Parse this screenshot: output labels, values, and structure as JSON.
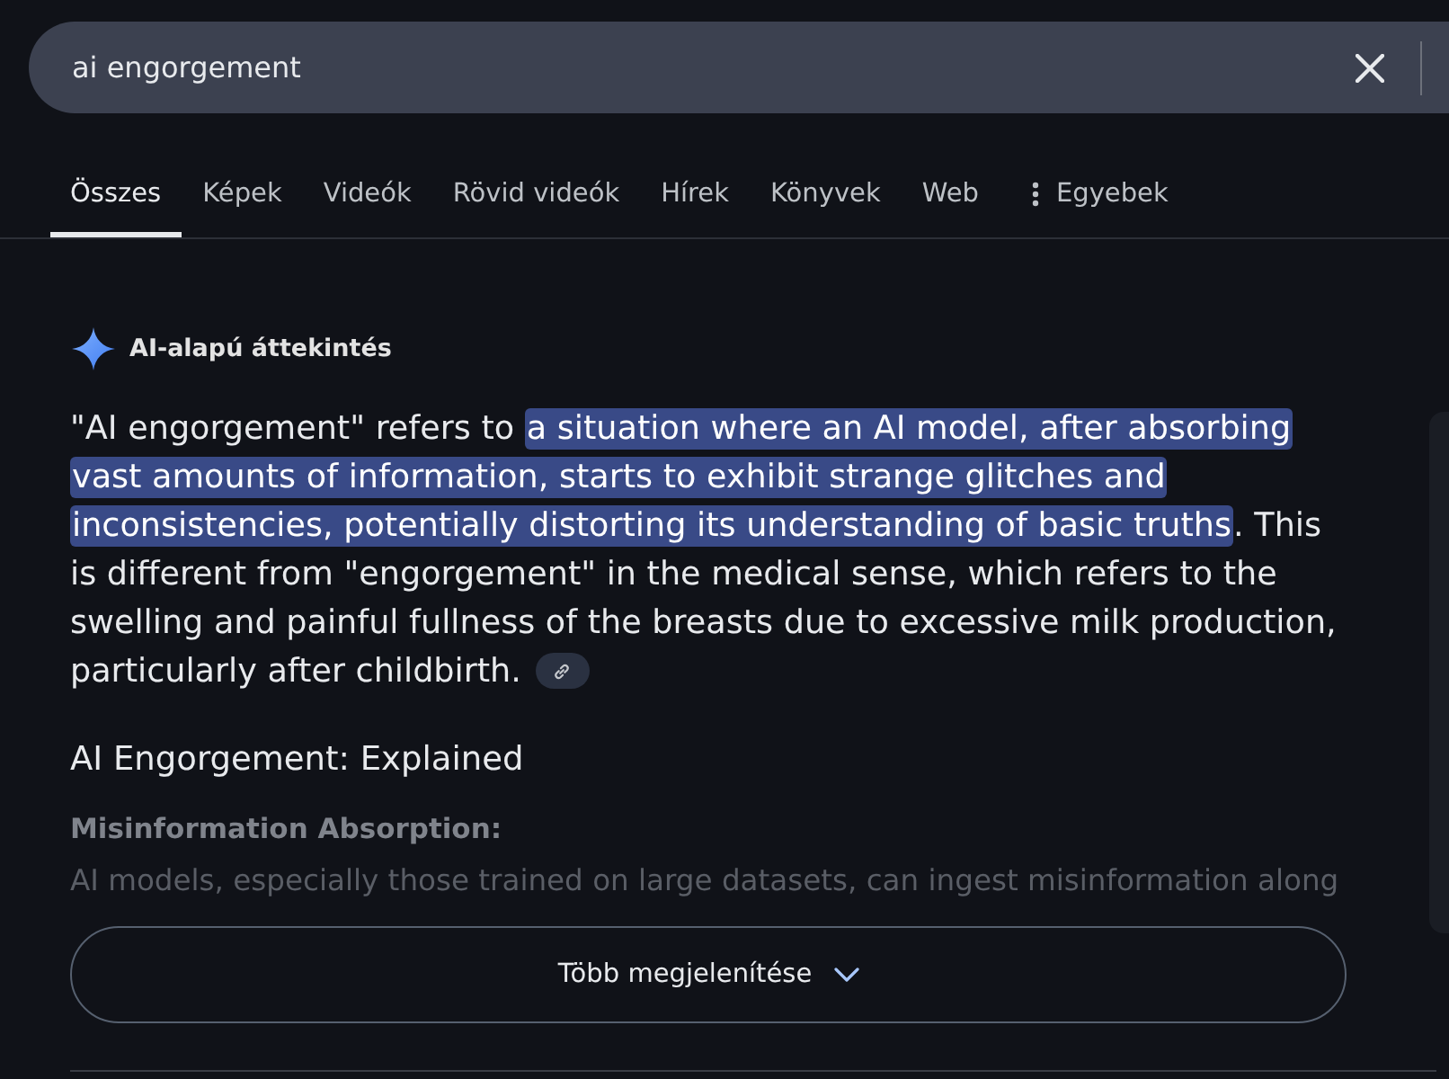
{
  "search": {
    "value": "ai engorgement"
  },
  "tabs": [
    {
      "label": "Összes",
      "selected": true,
      "kind": "tab"
    },
    {
      "label": "Képek",
      "selected": false,
      "kind": "tab"
    },
    {
      "label": "Videók",
      "selected": false,
      "kind": "tab"
    },
    {
      "label": "Rövid videók",
      "selected": false,
      "kind": "tab"
    },
    {
      "label": "Hírek",
      "selected": false,
      "kind": "tab"
    },
    {
      "label": "Könyvek",
      "selected": false,
      "kind": "tab"
    },
    {
      "label": "Web",
      "selected": false,
      "kind": "tab"
    },
    {
      "label": "Egyebek",
      "selected": false,
      "kind": "menu"
    }
  ],
  "ai_overview": {
    "title": "AI-alapú áttekintés",
    "text": "\"AI engorgement\" refers to **a situation where an AI model, after absorbing vast amounts of information, starts to exhibit strange glitches and inconsistencies, potentially distorting its understanding of basic truths**. This is different from \"engorgement\" in the medical sense, which refers to the swelling and painful fullness of the breasts due to excessive milk production, particularly after childbirth.",
    "heading": "AI Engorgement: Explained",
    "subheading": "Misinformation Absorption:",
    "preview": "AI models, especially those trained on large datasets, can ingest misinformation along",
    "show_more": "Több megjelenítése"
  }
}
